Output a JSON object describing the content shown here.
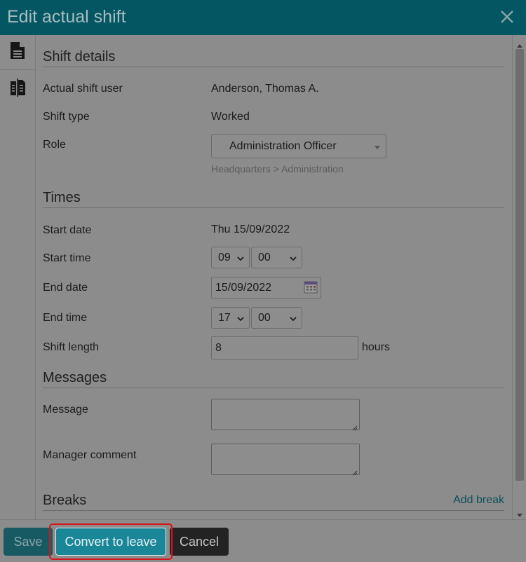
{
  "dialog": {
    "title": "Edit actual shift"
  },
  "icons": {
    "close": "close-icon",
    "details_tab": "document-icon",
    "history_tab": "compare-document-icon",
    "calendar": "calendar-icon"
  },
  "shift_details": {
    "heading": "Shift details",
    "user_label": "Actual shift user",
    "user_value": "Anderson, Thomas A.",
    "type_label": "Shift type",
    "type_value": "Worked",
    "role_label": "Role",
    "role_value": "Administration Officer",
    "role_path": "Headquarters > Administration"
  },
  "times": {
    "heading": "Times",
    "start_date_label": "Start date",
    "start_date_value": "Thu 15/09/2022",
    "start_time_label": "Start time",
    "start_hour": "09",
    "start_minute": "00",
    "end_date_label": "End date",
    "end_date_value": "15/09/2022",
    "end_time_label": "End time",
    "end_hour": "17",
    "end_minute": "00",
    "length_label": "Shift length",
    "length_value": "8",
    "length_unit": "hours"
  },
  "messages": {
    "heading": "Messages",
    "message_label": "Message",
    "message_value": "",
    "manager_label": "Manager comment",
    "manager_value": ""
  },
  "breaks": {
    "heading": "Breaks",
    "add_link": "Add break"
  },
  "footer": {
    "save": "Save",
    "convert": "Convert to leave",
    "cancel": "Cancel"
  },
  "colors": {
    "titlebar": "#055663",
    "primary_button": "#1a8799",
    "highlight": "#d6151b"
  }
}
